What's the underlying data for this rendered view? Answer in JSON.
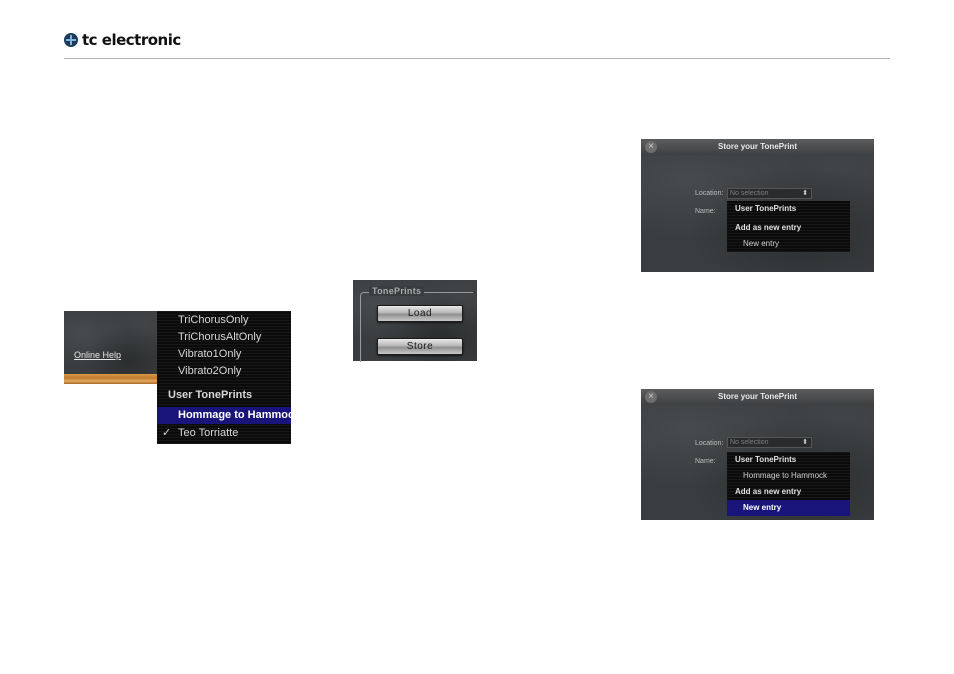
{
  "header": {
    "brand": "tc electronic"
  },
  "preset_menu": {
    "online_help": "Online Help",
    "items": [
      "TriChorusOnly",
      "TriChorusAltOnly",
      "Vibrato1Only",
      "Vibrato2Only"
    ],
    "section_header": "User TonePrints",
    "selected_item": "Hommage to Hammock",
    "checked_item": "Teo Torriatte",
    "check_mark": "✓"
  },
  "toneprints_panel": {
    "label": "TonePrints",
    "load_label": "Load",
    "store_label": "Store"
  },
  "store_dialog_1": {
    "title": "Store your TonePrint",
    "location_label": "Location:",
    "location_value": "No selection",
    "name_label": "Name:",
    "menu": {
      "header": "User TonePrints",
      "add_new": "Add as new entry",
      "new_entry": "New entry"
    }
  },
  "store_dialog_2": {
    "title": "Store your TonePrint",
    "location_label": "Location:",
    "location_value": "No selection",
    "name_label": "Name:",
    "menu": {
      "header": "User TonePrints",
      "existing_entry": "Hommage to Hammock",
      "add_new": "Add as new entry",
      "new_entry": "New entry"
    }
  },
  "colors": {
    "menu_highlight": "#18147a",
    "panel_dark": "#3a3d3f"
  }
}
